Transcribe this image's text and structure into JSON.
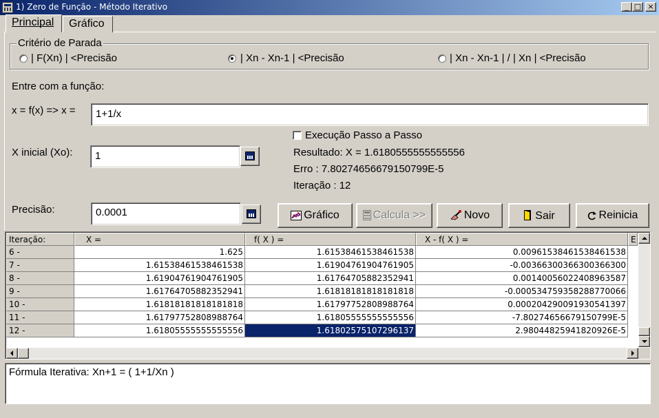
{
  "window": {
    "title": "1) Zero de Função - Método Iterativo",
    "minimize": "_",
    "maximize": "□",
    "close": "×"
  },
  "tabs": [
    {
      "label": "Principal",
      "active": true
    },
    {
      "label": "Gráfico",
      "active": false
    }
  ],
  "criterio": {
    "title": "Critério de Parada",
    "options": [
      {
        "label": "| F(Xn) |  <Precisão",
        "selected": false
      },
      {
        "label": "| Xn  -  Xn-1 |  <Precisão",
        "selected": true
      },
      {
        "label": "| Xn  -  Xn-1 | / | Xn |  <Precisão",
        "selected": false
      }
    ]
  },
  "form": {
    "entre_label": "Entre com a função:",
    "fx_label": "x = f(x)  => x =",
    "fx_value": "1+1/x",
    "xinicial_label": "X inicial (Xo):",
    "xinicial_value": "1",
    "precisao_label": "Precisão:",
    "precisao_value": "0.0001",
    "passo_label": "Execução Passo a Passo",
    "passo_checked": false
  },
  "results": {
    "resultado": "Resultado: X = 1.6180555555555556",
    "erro": "Erro : 7.80274656679150799E-5",
    "iteracao": "Iteração : 12"
  },
  "buttons": {
    "grafico": "Gráfico",
    "calcula": "Calcula >>",
    "novo": "Novo",
    "sair": "Sair",
    "reinicia": "Reinicia"
  },
  "grid": {
    "columns": [
      "Iteração:",
      "X =",
      "f( X ) =",
      "X - f( X ) =",
      "E"
    ],
    "rows": [
      [
        "6 -",
        "1.625",
        "1.61538461538461538",
        "0.00961538461538461538"
      ],
      [
        "7 -",
        "1.61538461538461538",
        "1.61904761904761905",
        "-0.00366300366300366300"
      ],
      [
        "8 -",
        "1.61904761904761905",
        "1.61764705882352941",
        "0.00140056022408963587"
      ],
      [
        "9 -",
        "1.61764705882352941",
        "1.61818181818181818",
        "-0.000534759358288770066"
      ],
      [
        "10 -",
        "1.61818181818181818",
        "1.61797752808988764",
        "0.000204290091930541397"
      ],
      [
        "11 -",
        "1.61797752808988764",
        "1.61805555555555556",
        "-7.80274656679150799E-5"
      ],
      [
        "12 -",
        "1.61805555555555556",
        "1.61802575107296137",
        "2.98044825941820926E-5"
      ]
    ],
    "selected_row": 6,
    "selected_col": 2
  },
  "memo": {
    "text": "Fórmula Iterativa: Xn+1 = ( 1+1/Xn )"
  },
  "icons": {
    "grafico": "chart-icon",
    "calcula": "calculator-icon",
    "novo": "eraser-icon",
    "sair": "exit-door-icon",
    "reinicia": "restart-arrow-icon"
  },
  "colors": {
    "title_start": "#0a246a",
    "title_end": "#a6caf0",
    "face": "#d4d0c8",
    "selection": "#0a246a"
  }
}
